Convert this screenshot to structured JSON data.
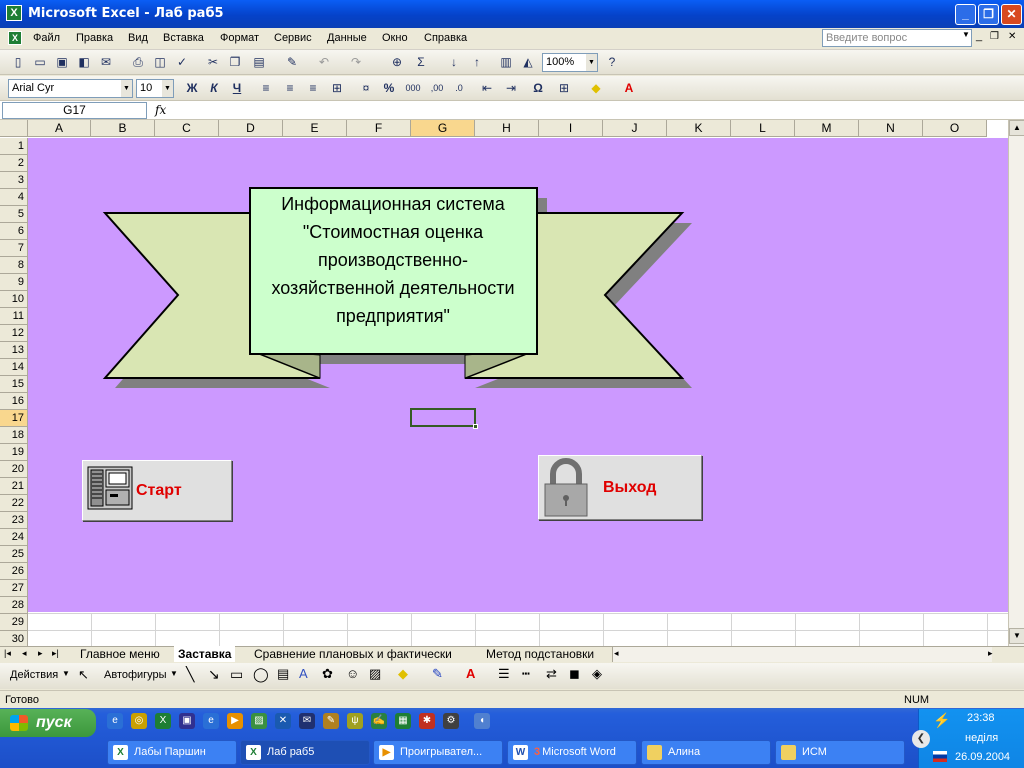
{
  "window": {
    "title": "Microsoft Excel - Лаб раб5"
  },
  "menu": {
    "items": [
      "Файл",
      "Правка",
      "Вид",
      "Вставка",
      "Формат",
      "Сервис",
      "Данные",
      "Окно",
      "Справка"
    ],
    "help_placeholder": "Введите вопрос"
  },
  "toolbar": {
    "zoom": "100%",
    "font": "Arial Cyr",
    "size": "10",
    "bold": "Ж",
    "italic": "К",
    "underline": "Ч",
    "percent": "%",
    "thousands": "000",
    "inc_dec": ",00",
    "omega": "Ω"
  },
  "formula_bar": {
    "name_box": "G17",
    "fx": "fx",
    "content": ""
  },
  "columns": [
    "A",
    "B",
    "C",
    "D",
    "E",
    "F",
    "G",
    "H",
    "I",
    "J",
    "K",
    "L",
    "M",
    "N",
    "O"
  ],
  "rows": [
    "1",
    "2",
    "3",
    "4",
    "5",
    "6",
    "7",
    "8",
    "9",
    "10",
    "11",
    "12",
    "13",
    "14",
    "15",
    "16",
    "17",
    "18",
    "19",
    "20",
    "21",
    "22",
    "23",
    "24",
    "25",
    "26",
    "27",
    "28",
    "29",
    "30"
  ],
  "selected": {
    "column": "G",
    "row": "17"
  },
  "banner": {
    "lines": [
      "Информационная система",
      "\"Стоимостная оценка",
      "производственно-",
      "хозяйственной деятельности",
      "предприятия\""
    ],
    "colors": {
      "ribbon": "#d9e6b3",
      "box": "#ccffcc",
      "shadow": "#808080"
    }
  },
  "buttons": {
    "start": "Старт",
    "exit": "Выход"
  },
  "sheet_tabs": [
    "Главное меню",
    "Заставка",
    "Сравнение плановых и фактически",
    "Метод подстановки"
  ],
  "active_tab": "Заставка",
  "drawing": {
    "actions": "Действия",
    "autoshapes": "Автофигуры"
  },
  "status": {
    "left": "Готово",
    "num": "NUM"
  },
  "taskbar": {
    "start": "пуск",
    "items": [
      "Лабы Паршин",
      "Лаб раб5",
      "Проигрывател...",
      "Microsoft Word",
      "Алина",
      "ИСМ"
    ],
    "word_count": "3",
    "clock": {
      "time": "23:38",
      "day": "неділя",
      "date": "26.09.2004"
    }
  },
  "colors": {
    "sheet_bg": "#cc99ff",
    "button_label": "#e00000",
    "titlebar": "#0a5ef5"
  }
}
